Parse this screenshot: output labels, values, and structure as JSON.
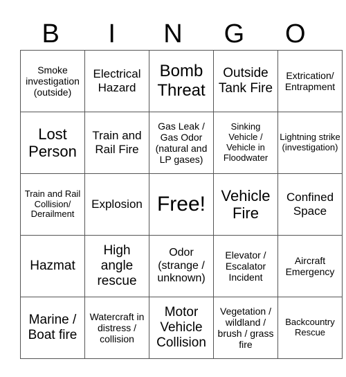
{
  "header": {
    "letters": [
      "B",
      "I",
      "N",
      "G",
      "O"
    ]
  },
  "board": {
    "rows": [
      [
        "Smoke investigation (outside)",
        "Electrical Hazard",
        "Bomb Threat",
        "Outside Tank Fire",
        "Extrication/ Entrapment"
      ],
      [
        "Lost Person",
        "Train and Rail Fire",
        "Gas Leak / Gas Odor (natural and LP gases)",
        "Sinking Vehicle / Vehicle in Floodwater",
        "Lightning strike (investigation)"
      ],
      [
        "Train and Rail Collision/ Derailment",
        "Explosion",
        "Free!",
        "Vehicle Fire",
        "Confined Space"
      ],
      [
        "Hazmat",
        "High angle rescue",
        "Odor (strange / unknown)",
        "Elevator / Escalator Incident",
        "Aircraft Emergency"
      ],
      [
        "Marine / Boat fire",
        "Watercraft in distress / collision",
        "Motor Vehicle Collision",
        "Vegetation / wildland / brush / grass fire",
        "Backcountry Rescue"
      ]
    ]
  }
}
